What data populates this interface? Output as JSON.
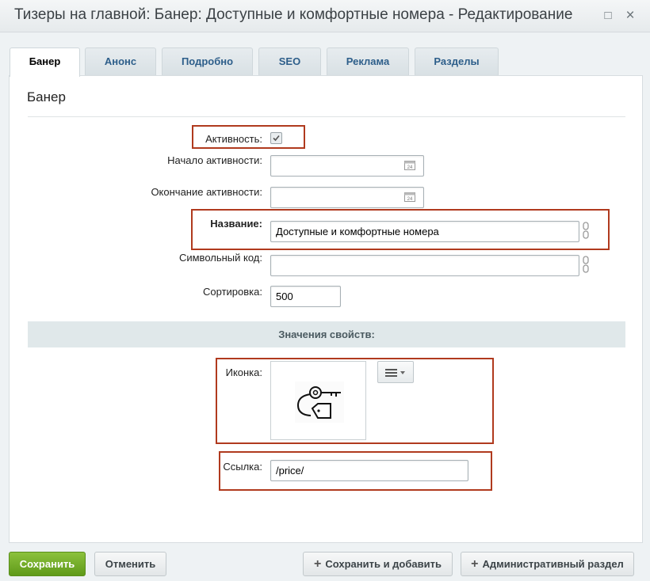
{
  "window": {
    "title": "Тизеры на главной: Банер: Доступные и комфортные номера - Редактирование",
    "maximize_glyph": "□",
    "close_glyph": "×"
  },
  "tabs": [
    {
      "label": "Банер",
      "active": true
    },
    {
      "label": "Анонс"
    },
    {
      "label": "Подробно"
    },
    {
      "label": "SEO"
    },
    {
      "label": "Реклама"
    },
    {
      "label": "Разделы"
    }
  ],
  "section_title": "Банер",
  "form": {
    "active": {
      "label": "Активность:",
      "checked": true
    },
    "start": {
      "label": "Начало активности:",
      "value": "",
      "calendar_day": "24"
    },
    "end": {
      "label": "Окончание активности:",
      "value": "",
      "calendar_day": "24"
    },
    "name": {
      "label": "Название:",
      "value": "Доступные и комфортные номера"
    },
    "code": {
      "label": "Символьный код:",
      "value": ""
    },
    "sort": {
      "label": "Сортировка:",
      "value": "500"
    }
  },
  "properties": {
    "heading": "Значения свойств:",
    "icon": {
      "label": "Иконка:",
      "image": "key-with-tag-icon",
      "menu_icon": "hamburger-dropdown-icon"
    },
    "link": {
      "label": "Ссылка:",
      "value": "/price/"
    }
  },
  "buttons": {
    "save": "Сохранить",
    "cancel": "Отменить",
    "save_and_add": "Сохранить и добавить",
    "admin_section": "Административный раздел"
  },
  "colors": {
    "accent_green": "#6aa823",
    "highlight_red": "#b03a1e",
    "tab_text": "#2d5e8a"
  }
}
